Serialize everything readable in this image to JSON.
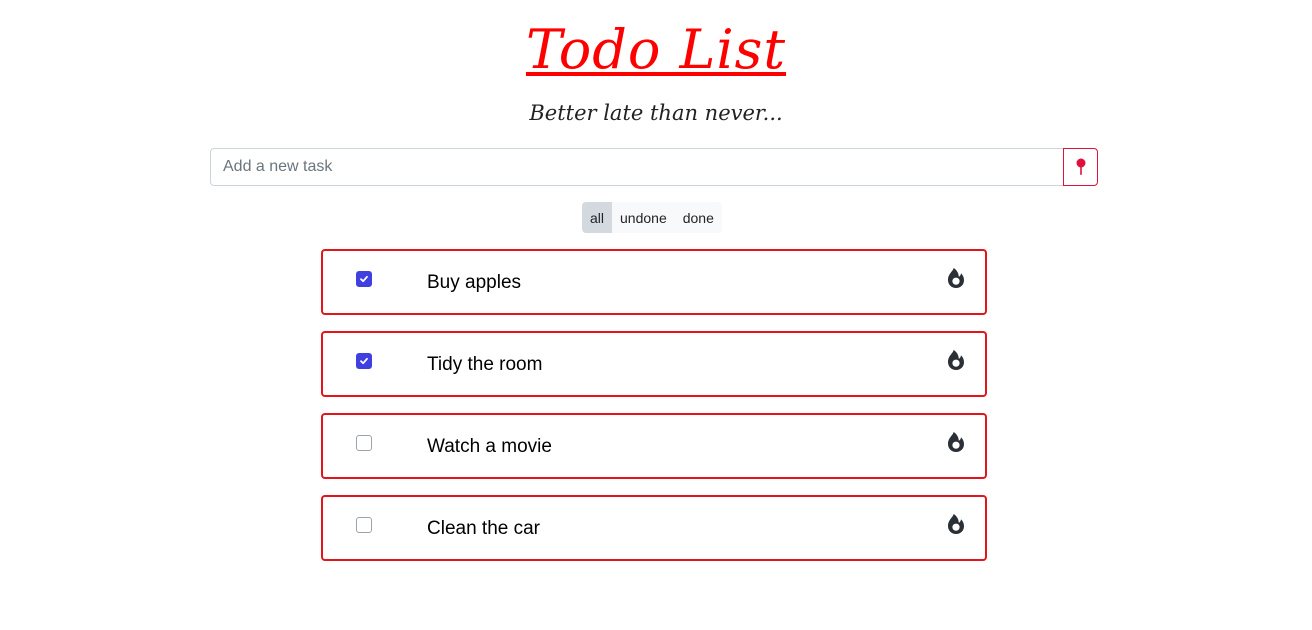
{
  "header": {
    "title": "Todo List",
    "subtitle": "Better late than never..."
  },
  "add_task": {
    "placeholder": "Add a new task",
    "value": "",
    "button_icon": "pin-icon"
  },
  "filters": {
    "options": [
      "all",
      "undone",
      "done"
    ],
    "selected": "all"
  },
  "tasks": [
    {
      "text": "Buy apples",
      "done": true,
      "delete_icon": "fire-icon"
    },
    {
      "text": "Tidy the room",
      "done": true,
      "delete_icon": "fire-icon"
    },
    {
      "text": "Watch a movie",
      "done": false,
      "delete_icon": "fire-icon"
    },
    {
      "text": "Clean the car",
      "done": false,
      "delete_icon": "fire-icon"
    }
  ],
  "colors": {
    "accent": "#ff0000",
    "card_border": "#e4141b",
    "checkbox_checked": "#4040e0",
    "add_button_border": "#dc143c"
  }
}
